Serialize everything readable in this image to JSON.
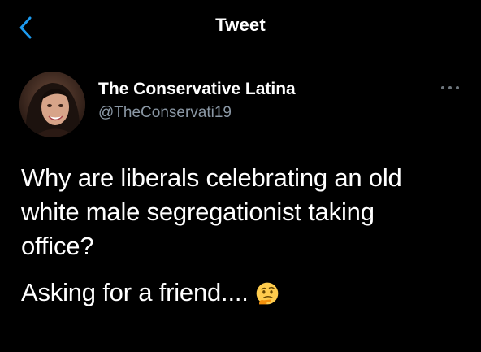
{
  "header": {
    "title": "Tweet",
    "back_icon": "chevron-left-icon",
    "accent_color": "#1d9bf0"
  },
  "tweet": {
    "author": {
      "name": "The Conservative Latina",
      "handle": "@TheConservati19",
      "avatar": "profile-photo"
    },
    "more_icon": "ellipsis-icon",
    "text_lines": [
      "Why are liberals celebrating an old",
      "white male segregationist taking",
      "office?"
    ],
    "second_paragraph": "Asking for a friend....",
    "emoji": "thinking-face-emoji"
  }
}
